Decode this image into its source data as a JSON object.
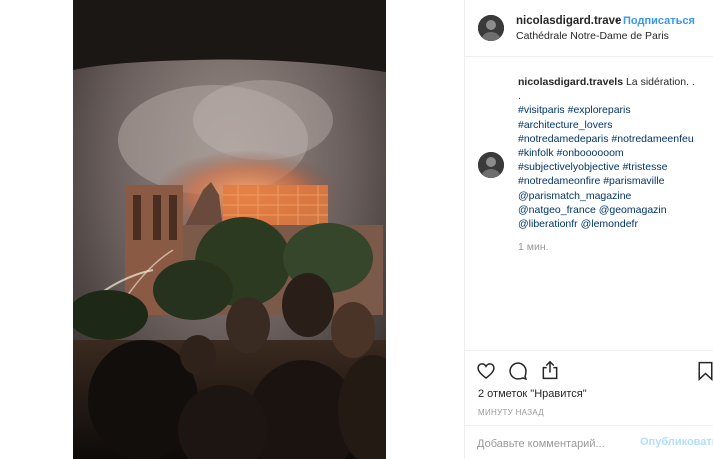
{
  "post": {
    "username": "nicolasdigard.trave",
    "dot": "•",
    "follow_label": "Подписаться",
    "location": "Cathédrale Notre-Dame de Paris"
  },
  "caption": {
    "username": "nicolasdigard.travels",
    "text": "La sidération. .",
    "dot_line": ".",
    "hashtags": [
      "#visitparis #exploreparis",
      "#architecture_lovers",
      "#notredamedeparis #notredameenfeu",
      "#kinfolk #onboooooom",
      "#subjectivelyobjective #tristesse",
      "#notredameonfire #parismaville",
      "@parismatch_magazine",
      "@natgeo_france @geomagazin",
      "@liberationfr @lemondefr"
    ],
    "time": "1 мин."
  },
  "actions": {
    "likes": "2 отметок \"Нравится\"",
    "ago": "МИНУТУ НАЗАД"
  },
  "comment_box": {
    "placeholder": "Добавьте комментарий...",
    "publish_label": "Опубликовать"
  },
  "icons": {
    "like": "heart-icon",
    "comment": "comment-bubble-icon",
    "share": "share-icon",
    "save": "bookmark-icon"
  },
  "colors": {
    "link": "#3897f0",
    "hashtag": "#003569",
    "muted": "#999999",
    "publish_disabled": "#b2dffc",
    "fire": "#e07a3a"
  }
}
